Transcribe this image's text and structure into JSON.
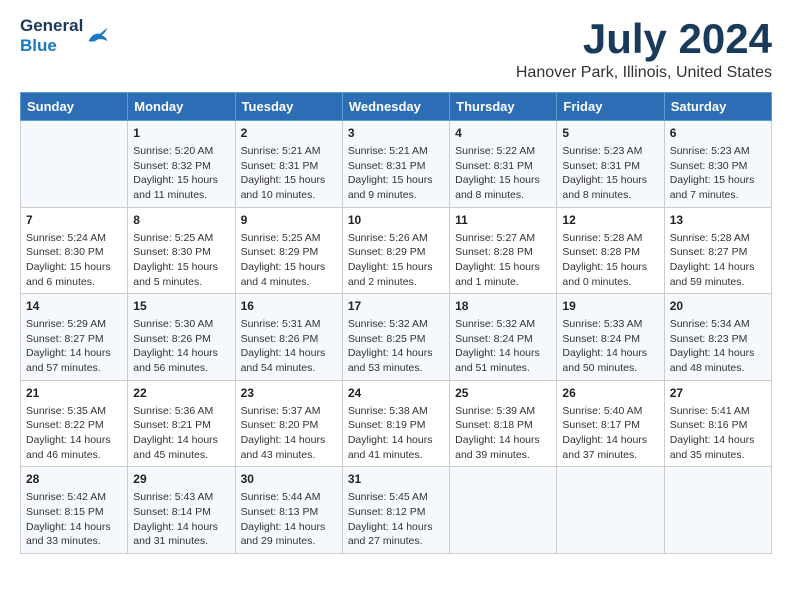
{
  "logo": {
    "line1": "General",
    "line2": "Blue"
  },
  "title": "July 2024",
  "location": "Hanover Park, Illinois, United States",
  "days_of_week": [
    "Sunday",
    "Monday",
    "Tuesday",
    "Wednesday",
    "Thursday",
    "Friday",
    "Saturday"
  ],
  "weeks": [
    [
      {
        "day": "",
        "sunrise": "",
        "sunset": "",
        "daylight": ""
      },
      {
        "day": "1",
        "sunrise": "Sunrise: 5:20 AM",
        "sunset": "Sunset: 8:32 PM",
        "daylight": "Daylight: 15 hours and 11 minutes."
      },
      {
        "day": "2",
        "sunrise": "Sunrise: 5:21 AM",
        "sunset": "Sunset: 8:31 PM",
        "daylight": "Daylight: 15 hours and 10 minutes."
      },
      {
        "day": "3",
        "sunrise": "Sunrise: 5:21 AM",
        "sunset": "Sunset: 8:31 PM",
        "daylight": "Daylight: 15 hours and 9 minutes."
      },
      {
        "day": "4",
        "sunrise": "Sunrise: 5:22 AM",
        "sunset": "Sunset: 8:31 PM",
        "daylight": "Daylight: 15 hours and 8 minutes."
      },
      {
        "day": "5",
        "sunrise": "Sunrise: 5:23 AM",
        "sunset": "Sunset: 8:31 PM",
        "daylight": "Daylight: 15 hours and 8 minutes."
      },
      {
        "day": "6",
        "sunrise": "Sunrise: 5:23 AM",
        "sunset": "Sunset: 8:30 PM",
        "daylight": "Daylight: 15 hours and 7 minutes."
      }
    ],
    [
      {
        "day": "7",
        "sunrise": "Sunrise: 5:24 AM",
        "sunset": "Sunset: 8:30 PM",
        "daylight": "Daylight: 15 hours and 6 minutes."
      },
      {
        "day": "8",
        "sunrise": "Sunrise: 5:25 AM",
        "sunset": "Sunset: 8:30 PM",
        "daylight": "Daylight: 15 hours and 5 minutes."
      },
      {
        "day": "9",
        "sunrise": "Sunrise: 5:25 AM",
        "sunset": "Sunset: 8:29 PM",
        "daylight": "Daylight: 15 hours and 4 minutes."
      },
      {
        "day": "10",
        "sunrise": "Sunrise: 5:26 AM",
        "sunset": "Sunset: 8:29 PM",
        "daylight": "Daylight: 15 hours and 2 minutes."
      },
      {
        "day": "11",
        "sunrise": "Sunrise: 5:27 AM",
        "sunset": "Sunset: 8:28 PM",
        "daylight": "Daylight: 15 hours and 1 minute."
      },
      {
        "day": "12",
        "sunrise": "Sunrise: 5:28 AM",
        "sunset": "Sunset: 8:28 PM",
        "daylight": "Daylight: 15 hours and 0 minutes."
      },
      {
        "day": "13",
        "sunrise": "Sunrise: 5:28 AM",
        "sunset": "Sunset: 8:27 PM",
        "daylight": "Daylight: 14 hours and 59 minutes."
      }
    ],
    [
      {
        "day": "14",
        "sunrise": "Sunrise: 5:29 AM",
        "sunset": "Sunset: 8:27 PM",
        "daylight": "Daylight: 14 hours and 57 minutes."
      },
      {
        "day": "15",
        "sunrise": "Sunrise: 5:30 AM",
        "sunset": "Sunset: 8:26 PM",
        "daylight": "Daylight: 14 hours and 56 minutes."
      },
      {
        "day": "16",
        "sunrise": "Sunrise: 5:31 AM",
        "sunset": "Sunset: 8:26 PM",
        "daylight": "Daylight: 14 hours and 54 minutes."
      },
      {
        "day": "17",
        "sunrise": "Sunrise: 5:32 AM",
        "sunset": "Sunset: 8:25 PM",
        "daylight": "Daylight: 14 hours and 53 minutes."
      },
      {
        "day": "18",
        "sunrise": "Sunrise: 5:32 AM",
        "sunset": "Sunset: 8:24 PM",
        "daylight": "Daylight: 14 hours and 51 minutes."
      },
      {
        "day": "19",
        "sunrise": "Sunrise: 5:33 AM",
        "sunset": "Sunset: 8:24 PM",
        "daylight": "Daylight: 14 hours and 50 minutes."
      },
      {
        "day": "20",
        "sunrise": "Sunrise: 5:34 AM",
        "sunset": "Sunset: 8:23 PM",
        "daylight": "Daylight: 14 hours and 48 minutes."
      }
    ],
    [
      {
        "day": "21",
        "sunrise": "Sunrise: 5:35 AM",
        "sunset": "Sunset: 8:22 PM",
        "daylight": "Daylight: 14 hours and 46 minutes."
      },
      {
        "day": "22",
        "sunrise": "Sunrise: 5:36 AM",
        "sunset": "Sunset: 8:21 PM",
        "daylight": "Daylight: 14 hours and 45 minutes."
      },
      {
        "day": "23",
        "sunrise": "Sunrise: 5:37 AM",
        "sunset": "Sunset: 8:20 PM",
        "daylight": "Daylight: 14 hours and 43 minutes."
      },
      {
        "day": "24",
        "sunrise": "Sunrise: 5:38 AM",
        "sunset": "Sunset: 8:19 PM",
        "daylight": "Daylight: 14 hours and 41 minutes."
      },
      {
        "day": "25",
        "sunrise": "Sunrise: 5:39 AM",
        "sunset": "Sunset: 8:18 PM",
        "daylight": "Daylight: 14 hours and 39 minutes."
      },
      {
        "day": "26",
        "sunrise": "Sunrise: 5:40 AM",
        "sunset": "Sunset: 8:17 PM",
        "daylight": "Daylight: 14 hours and 37 minutes."
      },
      {
        "day": "27",
        "sunrise": "Sunrise: 5:41 AM",
        "sunset": "Sunset: 8:16 PM",
        "daylight": "Daylight: 14 hours and 35 minutes."
      }
    ],
    [
      {
        "day": "28",
        "sunrise": "Sunrise: 5:42 AM",
        "sunset": "Sunset: 8:15 PM",
        "daylight": "Daylight: 14 hours and 33 minutes."
      },
      {
        "day": "29",
        "sunrise": "Sunrise: 5:43 AM",
        "sunset": "Sunset: 8:14 PM",
        "daylight": "Daylight: 14 hours and 31 minutes."
      },
      {
        "day": "30",
        "sunrise": "Sunrise: 5:44 AM",
        "sunset": "Sunset: 8:13 PM",
        "daylight": "Daylight: 14 hours and 29 minutes."
      },
      {
        "day": "31",
        "sunrise": "Sunrise: 5:45 AM",
        "sunset": "Sunset: 8:12 PM",
        "daylight": "Daylight: 14 hours and 27 minutes."
      },
      {
        "day": "",
        "sunrise": "",
        "sunset": "",
        "daylight": ""
      },
      {
        "day": "",
        "sunrise": "",
        "sunset": "",
        "daylight": ""
      },
      {
        "day": "",
        "sunrise": "",
        "sunset": "",
        "daylight": ""
      }
    ]
  ]
}
